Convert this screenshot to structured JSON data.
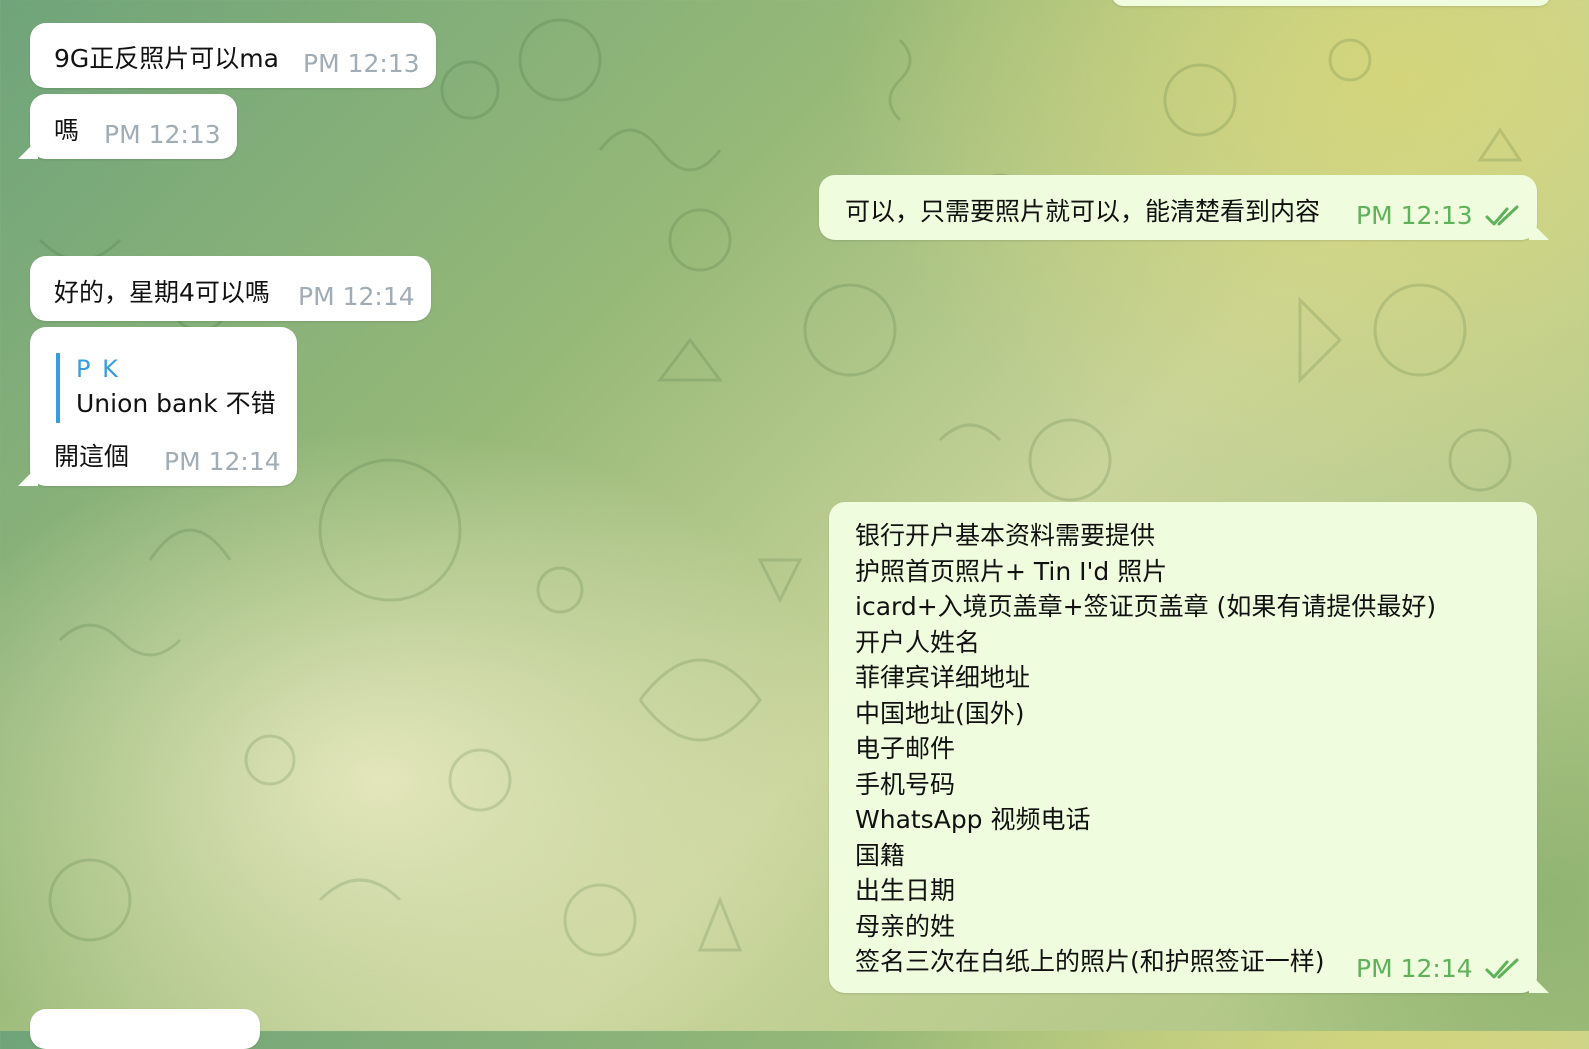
{
  "messages": [
    {
      "text": "9G正反照片可以ma",
      "time": "PM 12:13"
    },
    {
      "text": "嗎",
      "time": "PM 12:13"
    },
    {
      "text": "可以，只需要照片就可以，能清楚看到内容",
      "time": "PM 12:13",
      "status": "read"
    },
    {
      "text": "好的，星期4可以嗎",
      "time": "PM 12:14"
    },
    {
      "reply_name": "P K",
      "reply_text": "Union bank 不错",
      "text": "開這個",
      "time": "PM 12:14"
    },
    {
      "lines": [
        "银行开户基本资料需要提供",
        "护照首页照片+ Tin I'd 照片",
        "icard+入境页盖章+签证页盖章 (如果有请提供最好)",
        "开户人姓名",
        "菲律宾详细地址",
        "中国地址(国外)",
        "电子邮件",
        "手机号码",
        "WhatsApp 视频电话",
        "国籍",
        "出生日期",
        "母亲的姓",
        "签名三次在白纸上的照片(和护照签证一样)"
      ],
      "time": "PM 12:14",
      "status": "read"
    }
  ],
  "icons": {
    "read_status": "double-check-icon"
  },
  "colors": {
    "incoming": "#ffffff",
    "outgoing": "#effdde",
    "time_incoming": "#a0acb6",
    "time_outgoing": "#5fb15a",
    "reply_accent": "#3a9ddb"
  }
}
